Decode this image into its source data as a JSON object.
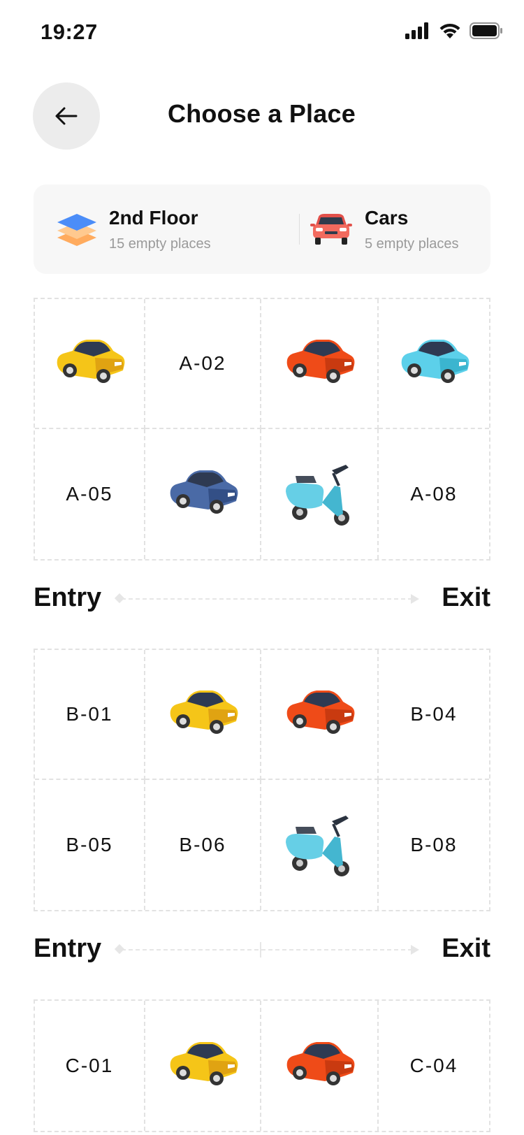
{
  "status_bar": {
    "time": "19:27"
  },
  "header": {
    "title": "Choose a Place"
  },
  "info": {
    "floor": {
      "title": "2nd Floor",
      "subtitle": "15 empty places"
    },
    "vehicle": {
      "title": "Cars",
      "subtitle": "5 empty places"
    }
  },
  "lane": {
    "entry": "Entry",
    "exit": "Exit"
  },
  "sections": {
    "a": {
      "spots": [
        {
          "vehicle": "yellow-car-icon"
        },
        {
          "label": "A-02"
        },
        {
          "vehicle": "red-car-icon"
        },
        {
          "vehicle": "cyan-car-icon"
        },
        {
          "label": "A-05"
        },
        {
          "vehicle": "blue-car-icon"
        },
        {
          "vehicle": "scooter-icon"
        },
        {
          "label": "A-08"
        }
      ]
    },
    "b": {
      "spots": [
        {
          "label": "B-01"
        },
        {
          "vehicle": "yellow-car-icon"
        },
        {
          "vehicle": "red-car-icon"
        },
        {
          "label": "B-04"
        },
        {
          "label": "B-05"
        },
        {
          "label": "B-06"
        },
        {
          "vehicle": "scooter-icon"
        },
        {
          "label": "B-08"
        }
      ]
    },
    "c": {
      "spots": [
        {
          "label": "C-01"
        },
        {
          "vehicle": "yellow-car-icon"
        },
        {
          "vehicle": "red-car-icon"
        },
        {
          "label": "C-04"
        }
      ]
    }
  },
  "colors": {
    "yellow_car": "#f5c518",
    "red_car": "#ef4b18",
    "cyan_car": "#5cd0ea",
    "blue_car": "#4a6aa6",
    "scooter": "#66cfe6",
    "floor_blue": "#4b8df8",
    "floor_orange": "#ffb36b",
    "car_coral": "#f26a5e"
  }
}
